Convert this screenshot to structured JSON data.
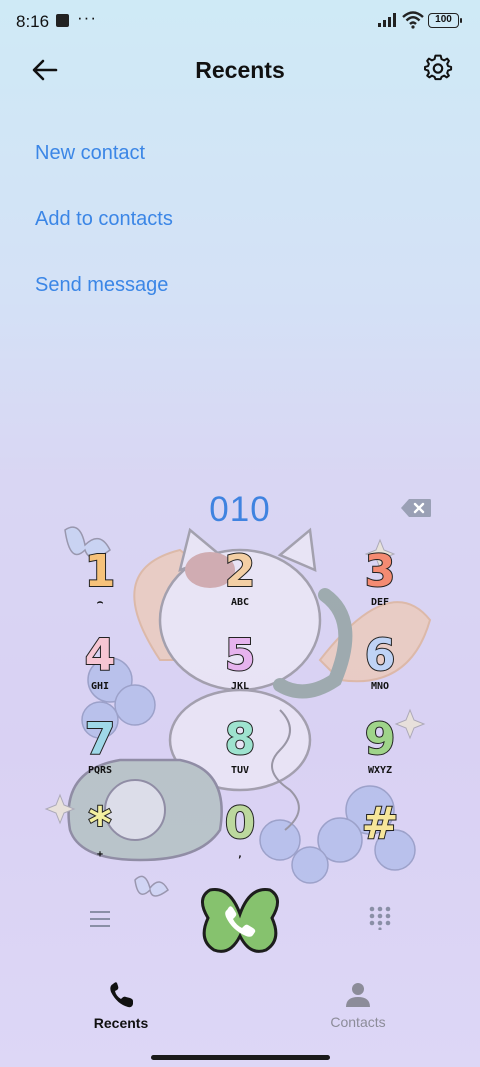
{
  "status_bar": {
    "time": "8:16",
    "more": "···",
    "battery": "100"
  },
  "header": {
    "title": "Recents",
    "back_icon": "arrow-left-icon",
    "settings_icon": "gear-icon"
  },
  "actions": [
    {
      "label": "New contact"
    },
    {
      "label": "Add to contacts"
    },
    {
      "label": "Send message"
    }
  ],
  "dialer": {
    "number": "010",
    "keys": [
      {
        "digit": "1",
        "letters": "⌢",
        "color": "#f6c27a"
      },
      {
        "digit": "2",
        "letters": "ABC",
        "color": "#f3cfa4"
      },
      {
        "digit": "3",
        "letters": "DEF",
        "color": "#f48b72"
      },
      {
        "digit": "4",
        "letters": "GHI",
        "color": "#f7c6d3"
      },
      {
        "digit": "5",
        "letters": "JKL",
        "color": "#e6b3ee"
      },
      {
        "digit": "6",
        "letters": "MNO",
        "color": "#bfd3f5"
      },
      {
        "digit": "7",
        "letters": "PQRS",
        "color": "#9fd8e8"
      },
      {
        "digit": "8",
        "letters": "TUV",
        "color": "#9ee3cf"
      },
      {
        "digit": "9",
        "letters": "WXYZ",
        "color": "#9fd48a"
      },
      {
        "digit": "*",
        "letters": "+",
        "color": "#f3f0a0"
      },
      {
        "digit": "0",
        "letters": ",",
        "color": "#bcd89e"
      },
      {
        "digit": "#",
        "letters": "",
        "color": "#f6e69a"
      }
    ]
  },
  "bottom_nav": {
    "recents": "Recents",
    "contacts": "Contacts"
  },
  "colors": {
    "accent": "#3b86e6",
    "call_button": "#86c26e"
  }
}
